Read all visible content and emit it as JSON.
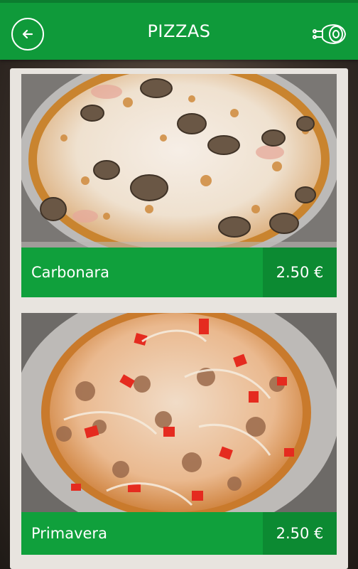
{
  "header": {
    "title": "PIZZAS",
    "back_icon": "back-arrow-icon",
    "right_icon": "ham-leg-icon",
    "brand_color": "#0f9a3a"
  },
  "items": [
    {
      "name": "Carbonara",
      "price": "2.50 €"
    },
    {
      "name": "Primavera",
      "price": "2.50 €"
    }
  ]
}
